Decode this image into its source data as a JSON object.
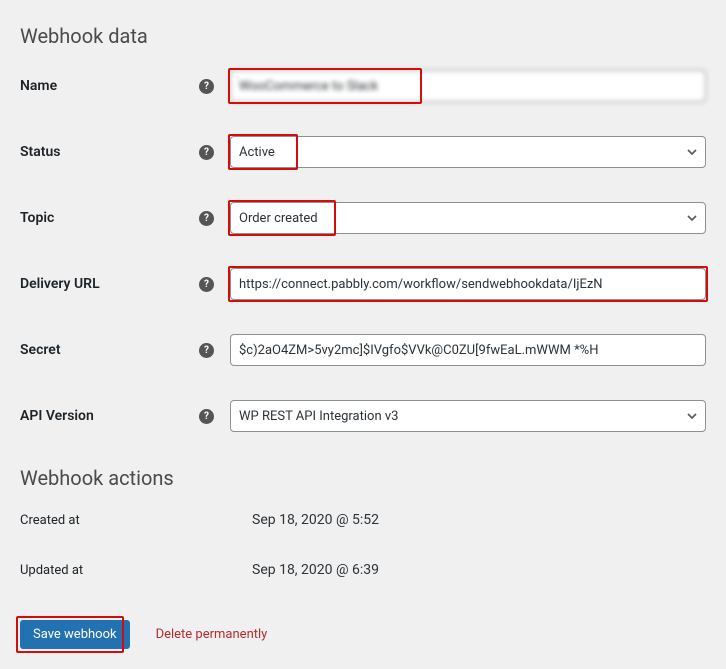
{
  "webhookData": {
    "heading": "Webhook data",
    "name": {
      "label": "Name",
      "value": "WooCommerce to Slack"
    },
    "status": {
      "label": "Status",
      "value": "Active"
    },
    "topic": {
      "label": "Topic",
      "value": "Order created"
    },
    "deliveryUrl": {
      "label": "Delivery URL",
      "value": "https://connect.pabbly.com/workflow/sendwebhookdata/IjEzN"
    },
    "secret": {
      "label": "Secret",
      "value": "$c)2aO4ZM>5vy2mc]$IVgfo$VVk@C0ZU[9fwEaL.mWWM *%H"
    },
    "apiVersion": {
      "label": "API Version",
      "value": "WP REST API Integration v3"
    }
  },
  "webhookActions": {
    "heading": "Webhook actions",
    "createdAt": {
      "label": "Created at",
      "value": "Sep 18, 2020 @ 5:52"
    },
    "updatedAt": {
      "label": "Updated at",
      "value": "Sep 18, 2020 @ 6:39"
    }
  },
  "buttons": {
    "save": "Save webhook",
    "delete": "Delete permanently"
  }
}
